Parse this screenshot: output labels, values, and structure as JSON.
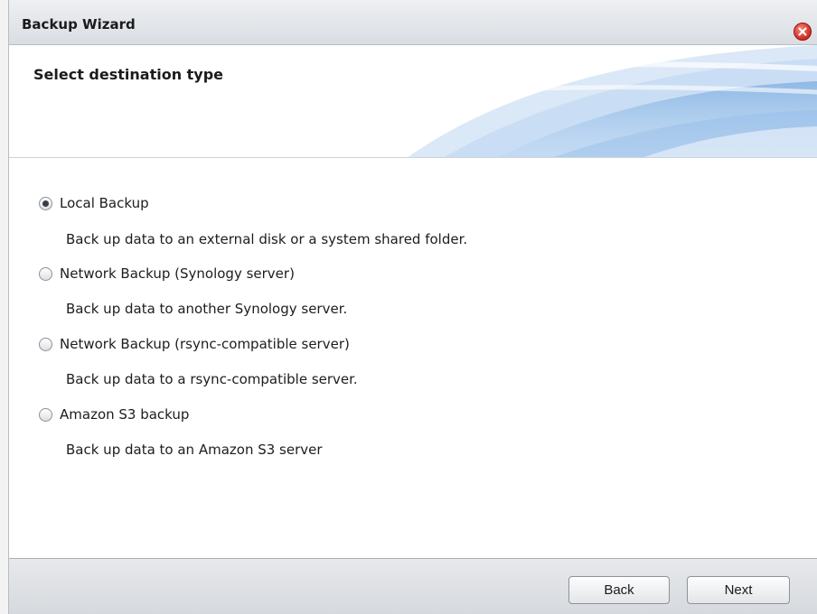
{
  "window": {
    "title": "Backup Wizard"
  },
  "header": {
    "step_title": "Select destination type"
  },
  "options": [
    {
      "label": "Local Backup",
      "description": "Back up data to an external disk or a system shared folder.",
      "checked": true
    },
    {
      "label": "Network Backup (Synology server)",
      "description": "Back up data to another Synology server.",
      "checked": false
    },
    {
      "label": "Network Backup (rsync-compatible server)",
      "description": "Back up data to a rsync-compatible server.",
      "checked": false
    },
    {
      "label": "Amazon S3 backup",
      "description": "Back up data to an Amazon S3 server",
      "checked": false
    }
  ],
  "footer": {
    "back_label": "Back",
    "next_label": "Next"
  },
  "colors": {
    "close_button": "#d9342a",
    "header_accent": "#6b9fd8"
  },
  "icons": {
    "close": "close-icon"
  }
}
